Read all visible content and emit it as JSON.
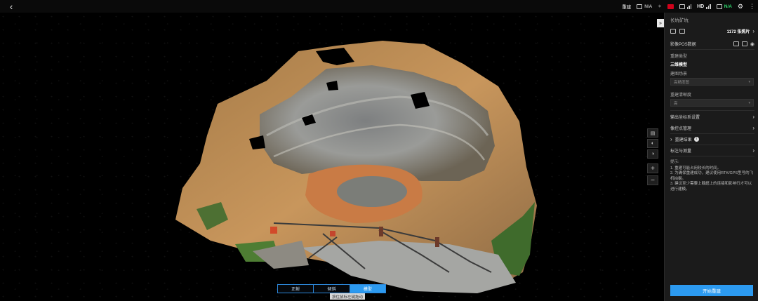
{
  "topbar": {
    "back_icon": "chevron-left-icon",
    "status": {
      "rebuild_label": "重建",
      "rtk_value": "N/A",
      "hd_label": "HD",
      "signal_value": "N/A",
      "signal_color": "#2fd36b",
      "rec_color": "#d0021b"
    }
  },
  "panel": {
    "title": "长坑矿坑",
    "photos_count": "1172 张照片",
    "pos_label": "影像POS数据",
    "rebuild_type_label": "重建类型",
    "rebuild_type_value": "三维模型",
    "scene_label": "建图场景",
    "scene_value": "高精度图",
    "resolution_label": "重建清晰度",
    "resolution_value": "高",
    "coords_label": "输出坐标系设置",
    "control_label": "像控点管理",
    "results_label": "重建结果",
    "annotate_label": "标注与测量",
    "tips_title": "提示:",
    "tips": [
      "1. 重建可能占用较长的时间。",
      "2. 为确保重建成功，建议使用RTK/GPS型号的飞机拍摄。",
      "3. 建议至少需要上载超上的连接和影响行才可以进行建模。"
    ],
    "submit_label": "开始重建"
  },
  "view_tabs": [
    {
      "label": "正射",
      "active": false
    },
    {
      "label": "倾斜",
      "active": false
    },
    {
      "label": "模型",
      "active": true
    }
  ],
  "tooltip": "按住鼠标左键拖动",
  "accent_color": "#2c9af0"
}
